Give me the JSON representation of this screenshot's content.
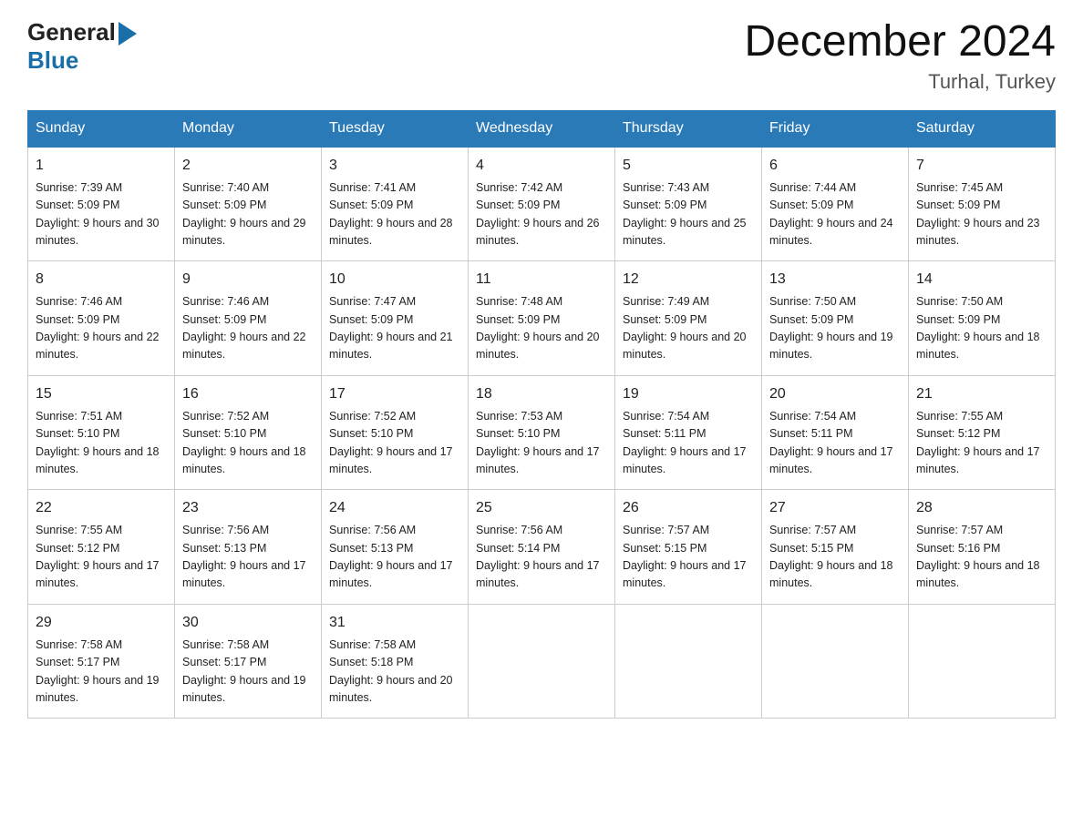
{
  "header": {
    "logo_general": "General",
    "logo_blue": "Blue",
    "title": "December 2024",
    "location": "Turhal, Turkey"
  },
  "days_of_week": [
    "Sunday",
    "Monday",
    "Tuesday",
    "Wednesday",
    "Thursday",
    "Friday",
    "Saturday"
  ],
  "weeks": [
    [
      {
        "day": "1",
        "sunrise": "7:39 AM",
        "sunset": "5:09 PM",
        "daylight": "9 hours and 30 minutes."
      },
      {
        "day": "2",
        "sunrise": "7:40 AM",
        "sunset": "5:09 PM",
        "daylight": "9 hours and 29 minutes."
      },
      {
        "day": "3",
        "sunrise": "7:41 AM",
        "sunset": "5:09 PM",
        "daylight": "9 hours and 28 minutes."
      },
      {
        "day": "4",
        "sunrise": "7:42 AM",
        "sunset": "5:09 PM",
        "daylight": "9 hours and 26 minutes."
      },
      {
        "day": "5",
        "sunrise": "7:43 AM",
        "sunset": "5:09 PM",
        "daylight": "9 hours and 25 minutes."
      },
      {
        "day": "6",
        "sunrise": "7:44 AM",
        "sunset": "5:09 PM",
        "daylight": "9 hours and 24 minutes."
      },
      {
        "day": "7",
        "sunrise": "7:45 AM",
        "sunset": "5:09 PM",
        "daylight": "9 hours and 23 minutes."
      }
    ],
    [
      {
        "day": "8",
        "sunrise": "7:46 AM",
        "sunset": "5:09 PM",
        "daylight": "9 hours and 22 minutes."
      },
      {
        "day": "9",
        "sunrise": "7:46 AM",
        "sunset": "5:09 PM",
        "daylight": "9 hours and 22 minutes."
      },
      {
        "day": "10",
        "sunrise": "7:47 AM",
        "sunset": "5:09 PM",
        "daylight": "9 hours and 21 minutes."
      },
      {
        "day": "11",
        "sunrise": "7:48 AM",
        "sunset": "5:09 PM",
        "daylight": "9 hours and 20 minutes."
      },
      {
        "day": "12",
        "sunrise": "7:49 AM",
        "sunset": "5:09 PM",
        "daylight": "9 hours and 20 minutes."
      },
      {
        "day": "13",
        "sunrise": "7:50 AM",
        "sunset": "5:09 PM",
        "daylight": "9 hours and 19 minutes."
      },
      {
        "day": "14",
        "sunrise": "7:50 AM",
        "sunset": "5:09 PM",
        "daylight": "9 hours and 18 minutes."
      }
    ],
    [
      {
        "day": "15",
        "sunrise": "7:51 AM",
        "sunset": "5:10 PM",
        "daylight": "9 hours and 18 minutes."
      },
      {
        "day": "16",
        "sunrise": "7:52 AM",
        "sunset": "5:10 PM",
        "daylight": "9 hours and 18 minutes."
      },
      {
        "day": "17",
        "sunrise": "7:52 AM",
        "sunset": "5:10 PM",
        "daylight": "9 hours and 17 minutes."
      },
      {
        "day": "18",
        "sunrise": "7:53 AM",
        "sunset": "5:10 PM",
        "daylight": "9 hours and 17 minutes."
      },
      {
        "day": "19",
        "sunrise": "7:54 AM",
        "sunset": "5:11 PM",
        "daylight": "9 hours and 17 minutes."
      },
      {
        "day": "20",
        "sunrise": "7:54 AM",
        "sunset": "5:11 PM",
        "daylight": "9 hours and 17 minutes."
      },
      {
        "day": "21",
        "sunrise": "7:55 AM",
        "sunset": "5:12 PM",
        "daylight": "9 hours and 17 minutes."
      }
    ],
    [
      {
        "day": "22",
        "sunrise": "7:55 AM",
        "sunset": "5:12 PM",
        "daylight": "9 hours and 17 minutes."
      },
      {
        "day": "23",
        "sunrise": "7:56 AM",
        "sunset": "5:13 PM",
        "daylight": "9 hours and 17 minutes."
      },
      {
        "day": "24",
        "sunrise": "7:56 AM",
        "sunset": "5:13 PM",
        "daylight": "9 hours and 17 minutes."
      },
      {
        "day": "25",
        "sunrise": "7:56 AM",
        "sunset": "5:14 PM",
        "daylight": "9 hours and 17 minutes."
      },
      {
        "day": "26",
        "sunrise": "7:57 AM",
        "sunset": "5:15 PM",
        "daylight": "9 hours and 17 minutes."
      },
      {
        "day": "27",
        "sunrise": "7:57 AM",
        "sunset": "5:15 PM",
        "daylight": "9 hours and 18 minutes."
      },
      {
        "day": "28",
        "sunrise": "7:57 AM",
        "sunset": "5:16 PM",
        "daylight": "9 hours and 18 minutes."
      }
    ],
    [
      {
        "day": "29",
        "sunrise": "7:58 AM",
        "sunset": "5:17 PM",
        "daylight": "9 hours and 19 minutes."
      },
      {
        "day": "30",
        "sunrise": "7:58 AM",
        "sunset": "5:17 PM",
        "daylight": "9 hours and 19 minutes."
      },
      {
        "day": "31",
        "sunrise": "7:58 AM",
        "sunset": "5:18 PM",
        "daylight": "9 hours and 20 minutes."
      },
      null,
      null,
      null,
      null
    ]
  ]
}
